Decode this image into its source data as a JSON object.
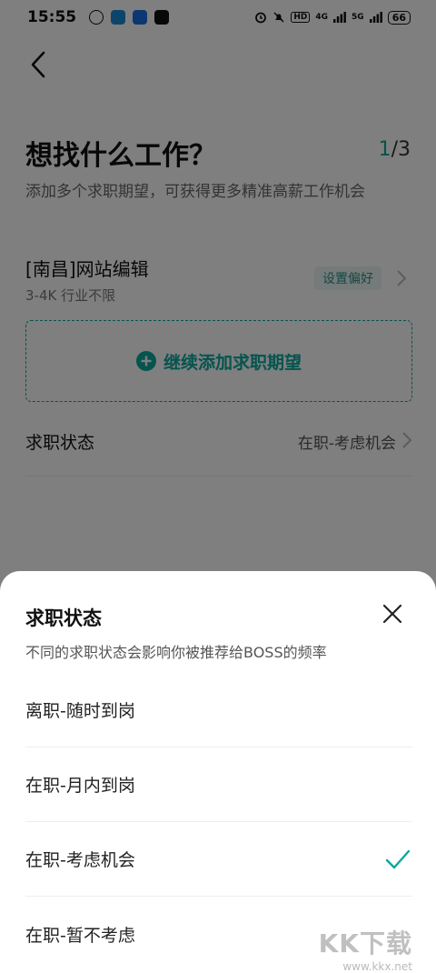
{
  "status_bar": {
    "time": "15:55",
    "network_hd": "HD",
    "network_4g": "4G",
    "network_5g": "5G",
    "battery": "66"
  },
  "header": {
    "title": "想找什么工作？",
    "step_current": "1",
    "step_total": "/3",
    "subtitle": "添加多个求职期望，可获得更多精准高薪工作机会"
  },
  "expectation": {
    "title": "[南昌]网站编辑",
    "detail": "3-4K 行业不限",
    "pref_tag": "设置偏好"
  },
  "add_more": {
    "label": "继续添加求职期望"
  },
  "job_status_row": {
    "label": "求职状态",
    "value": "在职-考虑机会"
  },
  "sheet": {
    "title": "求职状态",
    "description": "不同的求职状态会影响你被推荐给BOSS的频率",
    "options": [
      {
        "label": "离职-随时到岗",
        "selected": false
      },
      {
        "label": "在职-月内到岗",
        "selected": false
      },
      {
        "label": "在职-考虑机会",
        "selected": true
      },
      {
        "label": "在职-暂不考虑",
        "selected": false
      }
    ]
  },
  "watermark": {
    "logo": "KK下载",
    "url": "www.kkx.net"
  },
  "colors": {
    "accent": "#0aa89e",
    "overlay": "rgba(0,0,0,0.5)"
  }
}
